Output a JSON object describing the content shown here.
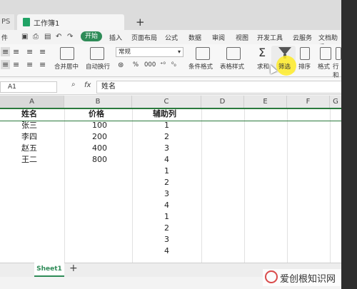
{
  "titlebar": {
    "app_tab": "PS",
    "doc_tab": "工作簿1",
    "new_tab": "+"
  },
  "menu": {
    "file": "件",
    "start_button": "开始",
    "items": [
      "插入",
      "页面布局",
      "公式",
      "数据",
      "审阅",
      "视图",
      "开发工具",
      "云服务",
      "文档助手"
    ]
  },
  "ribbon": {
    "merge_center": "合并居中",
    "wrap_text": "自动换行",
    "number_format": "常规",
    "percent": "%",
    "thousands": "000",
    "cond_format": "条件格式",
    "table_style": "表格样式",
    "sum": "求和",
    "filter": "筛选",
    "sort": "排序",
    "format": "格式",
    "row_col": "行和列"
  },
  "formula_bar": {
    "name_box": "A1",
    "fx": "fx",
    "value": "姓名"
  },
  "columns": [
    "A",
    "B",
    "C",
    "D",
    "E",
    "F",
    "G"
  ],
  "table": {
    "headers": [
      "姓名",
      "价格",
      "辅助列"
    ],
    "names": [
      "张三",
      "李四",
      "赵五",
      "王二"
    ],
    "prices": [
      "100",
      "200",
      "400",
      "800"
    ],
    "helper": [
      "1",
      "2",
      "3",
      "4",
      "1",
      "2",
      "3",
      "4",
      "1",
      "2",
      "3",
      "4"
    ]
  },
  "sheets": {
    "active": "Sheet1",
    "add": "+"
  },
  "watermark": "爱创根知识网"
}
